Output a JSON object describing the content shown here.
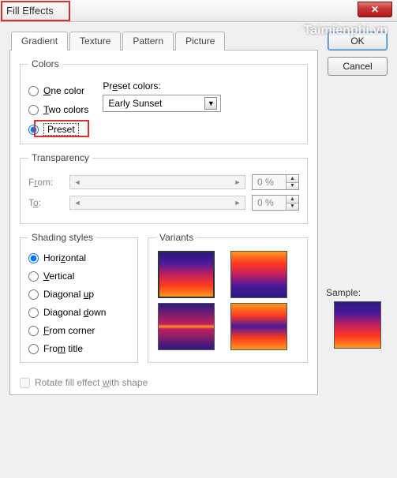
{
  "window": {
    "title": "Fill Effects",
    "close_glyph": "✕",
    "watermark": "Taimienphi.vn"
  },
  "tabs": [
    "Gradient",
    "Texture",
    "Pattern",
    "Picture"
  ],
  "active_tab": 0,
  "gradient": {
    "colors_legend": "Colors",
    "radio_one": "One color",
    "radio_two": "Two colors",
    "radio_preset": "Preset",
    "preset_label": "Preset colors:",
    "preset_value": "Early Sunset"
  },
  "transparency": {
    "legend": "Transparency",
    "from_label": "From:",
    "to_label": "To:",
    "from_value": "0 %",
    "to_value": "0 %"
  },
  "shading": {
    "legend": "Shading styles",
    "horizontal": "Horizontal",
    "vertical": "Vertical",
    "diag_up": "Diagonal up",
    "diag_down": "Diagonal down",
    "from_corner": "From corner",
    "from_title": "From title"
  },
  "variants_legend": "Variants",
  "rotate_label": "Rotate fill effect with shape",
  "buttons": {
    "ok": "OK",
    "cancel": "Cancel"
  },
  "sample_label": "Sample:"
}
